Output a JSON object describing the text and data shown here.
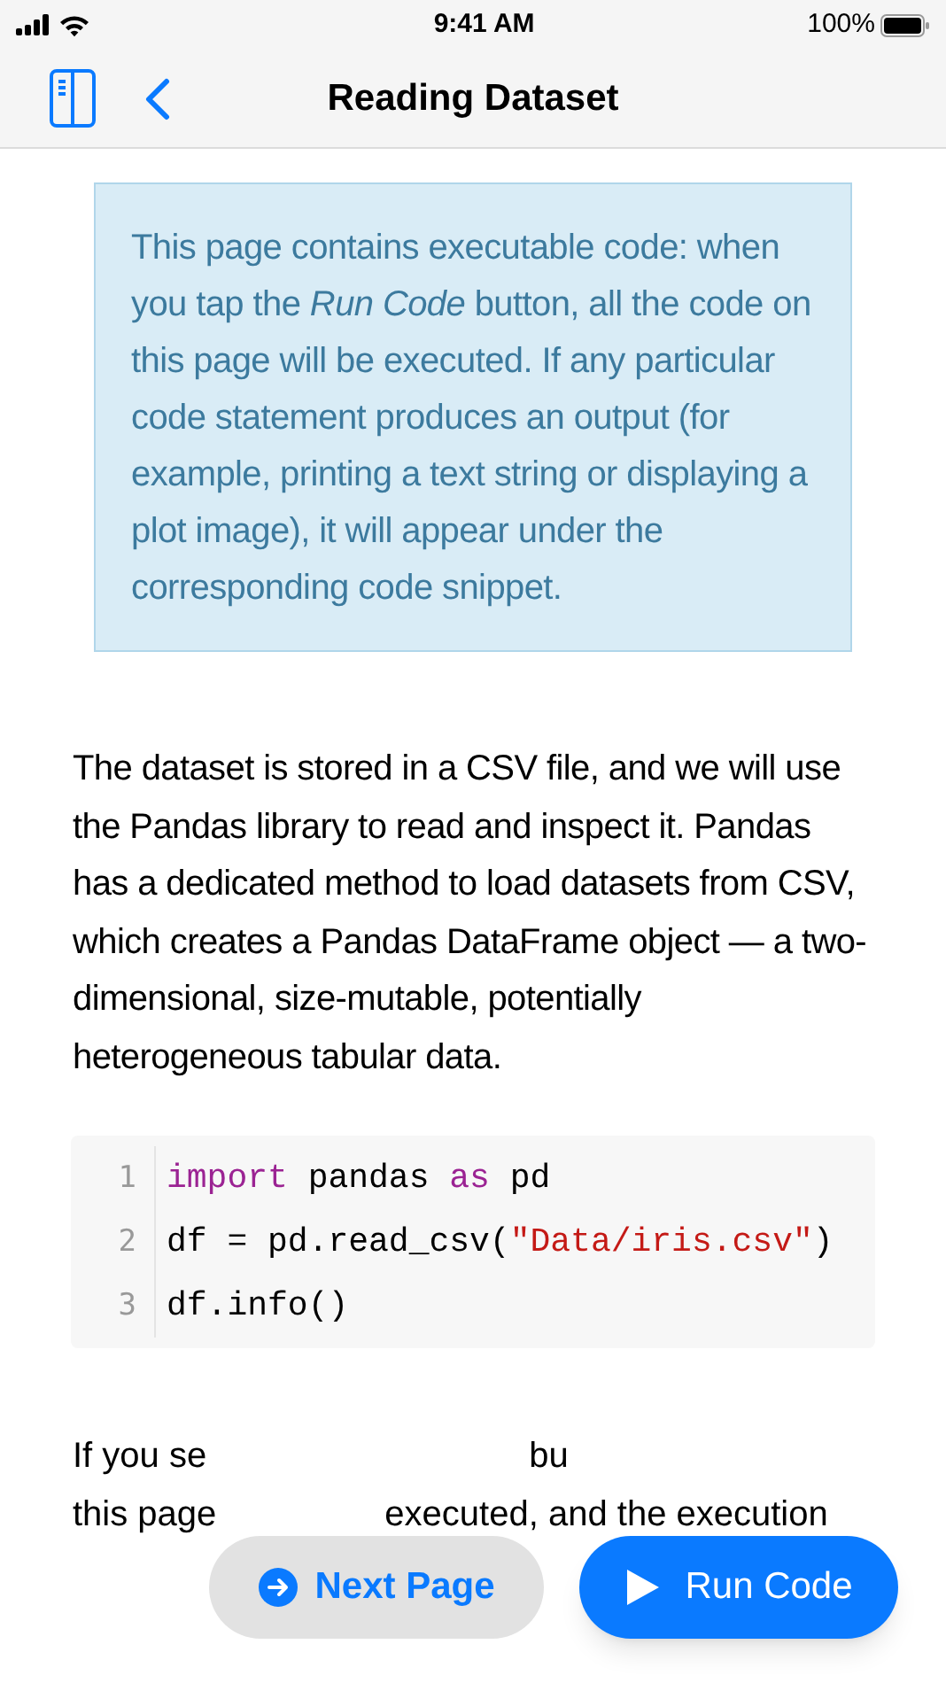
{
  "status_bar": {
    "time": "9:41 AM",
    "battery": "100%"
  },
  "nav_bar": {
    "title": "Reading Dataset"
  },
  "callout": "This page contains executable code: when you tap the *Run Code* button, all the code on this page will be executed. If any particular code statement produces an output (for example, printing a text string or displaying a plot image), it will appear under the corresponding code snippet.",
  "paragraph": "The dataset is stored in a CSV file, and we will use the Pandas library to read and inspect it. Pandas has a dedicated method to load datasets from CSV, which creates a Pandas DataFrame object — a two-dimensional, size-mutable, potentially heterogeneous tabular data.",
  "code": [
    {
      "number": "1",
      "tokens": [
        {
          "kind": "keyword",
          "text": "import"
        },
        {
          "kind": "plain",
          "text": " pandas "
        },
        {
          "kind": "keyword",
          "text": "as"
        },
        {
          "kind": "plain",
          "text": " pd"
        }
      ]
    },
    {
      "number": "2",
      "tokens": [
        {
          "kind": "plain",
          "text": "df = pd.read_csv("
        },
        {
          "kind": "string",
          "text": "\"Data/iris.csv\""
        },
        {
          "kind": "plain",
          "text": ")"
        }
      ]
    },
    {
      "number": "3",
      "tokens": [
        {
          "kind": "plain",
          "text": "df.info()"
        }
      ]
    }
  ],
  "partial_paragraph": {
    "line_1_start": "If you se",
    "line_1_middle": "bu",
    "line_2_start": "this page",
    "line_2_end": "executed, and the execution"
  },
  "buttons": {
    "next": "Next Page",
    "run": "Run Code"
  }
}
